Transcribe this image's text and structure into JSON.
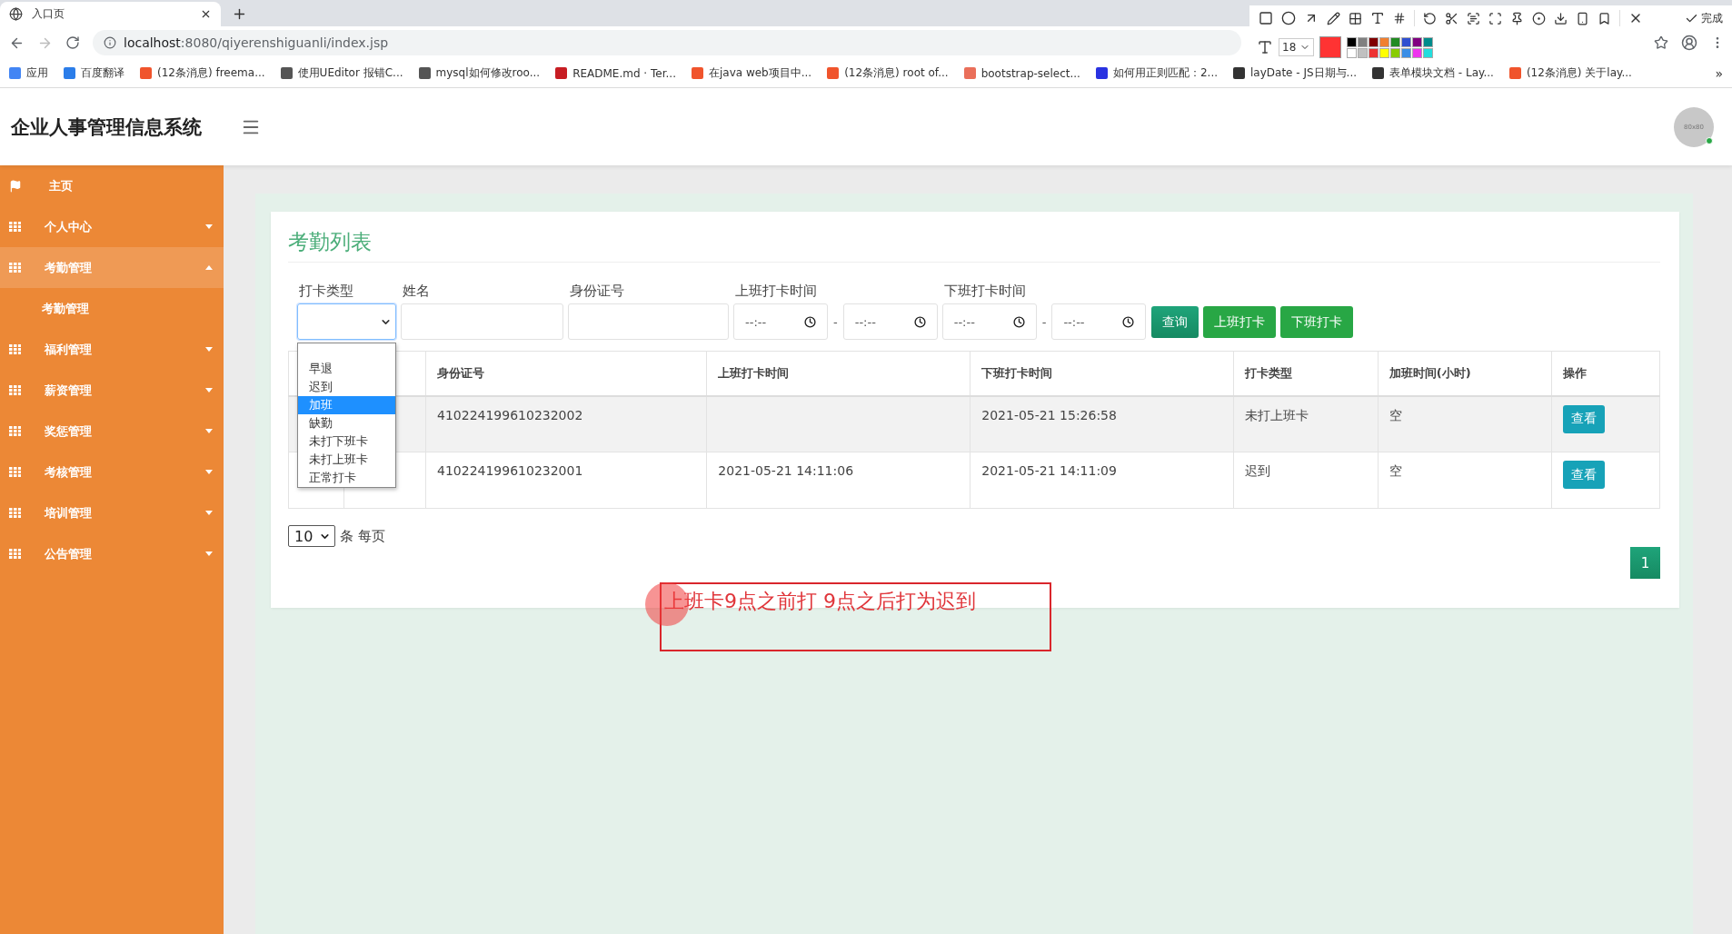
{
  "browser": {
    "tab_title": "入口页",
    "url_host": "localhost",
    "url_rest": ":8080/qiyerenshiguanli/index.jsp",
    "bookmarks": [
      {
        "label": "应用",
        "kind": "apps"
      },
      {
        "label": "百度翻译",
        "kind": "translate"
      },
      {
        "label": "(12条消息) freema...",
        "kind": "csdn"
      },
      {
        "label": "使用UEditor 报错C...",
        "kind": "feather"
      },
      {
        "label": "mysql如何修改roo...",
        "kind": "feather"
      },
      {
        "label": "README.md · Ter...",
        "kind": "gitee"
      },
      {
        "label": "在java web项目中...",
        "kind": "csdn"
      },
      {
        "label": "(12条消息) root of...",
        "kind": "csdn"
      },
      {
        "label": "bootstrap-select...",
        "kind": "jianshu"
      },
      {
        "label": "如何用正则匹配：2...",
        "kind": "baidu"
      },
      {
        "label": "layDate - JS日期与...",
        "kind": "layui"
      },
      {
        "label": "表单模块文档 - Lay...",
        "kind": "layui"
      },
      {
        "label": "(12条消息) 关于lay...",
        "kind": "csdn"
      }
    ],
    "more": "»"
  },
  "capture_toolbar": {
    "font_size": "18",
    "done_label": "完成"
  },
  "app": {
    "title": "企业人事管理信息系统",
    "avatar_text": "80x80"
  },
  "sidebar": {
    "items": [
      {
        "label": "主页",
        "kind": "link"
      },
      {
        "label": "个人中心",
        "kind": "group",
        "expanded": false
      },
      {
        "label": "考勤管理",
        "kind": "group",
        "expanded": true,
        "children": [
          {
            "label": "考勤管理"
          }
        ]
      },
      {
        "label": "福利管理",
        "kind": "group",
        "expanded": false
      },
      {
        "label": "薪资管理",
        "kind": "group",
        "expanded": false
      },
      {
        "label": "奖惩管理",
        "kind": "group",
        "expanded": false
      },
      {
        "label": "考核管理",
        "kind": "group",
        "expanded": false
      },
      {
        "label": "培训管理",
        "kind": "group",
        "expanded": false
      },
      {
        "label": "公告管理",
        "kind": "group",
        "expanded": false
      }
    ]
  },
  "page_title": "考勤列表",
  "filters": [
    {
      "label": "打卡类型",
      "kind": "select"
    },
    {
      "label": "姓名",
      "kind": "text"
    },
    {
      "label": "身份证号",
      "kind": "text"
    },
    {
      "label": "上班打卡时间",
      "kind": "time_range",
      "placeholders": [
        "--:--",
        "--:--"
      ],
      "separator": "-"
    },
    {
      "label": "下班打卡时间",
      "kind": "time_range",
      "placeholders": [
        "--:--",
        "--:--"
      ],
      "separator": "-"
    }
  ],
  "buttons": [
    {
      "label": "查询",
      "kind": "search"
    },
    {
      "label": "上班打卡",
      "kind": "action"
    },
    {
      "label": "下班打卡",
      "kind": "action"
    }
  ],
  "dropdown": {
    "options": [
      {
        "label": "早退",
        "selected": false
      },
      {
        "label": "迟到",
        "selected": false
      },
      {
        "label": "加班",
        "selected": true
      },
      {
        "label": "缺勤",
        "selected": false
      },
      {
        "label": "未打下班卡",
        "selected": false
      },
      {
        "label": "未打上班卡",
        "selected": false
      },
      {
        "label": "正常打卡",
        "selected": false
      }
    ]
  },
  "table": {
    "columns": [
      "身份证号",
      "上班打卡时间",
      "下班打卡时间",
      "打卡类型",
      "加班时间(小时)",
      "操作"
    ],
    "rows": [
      {
        "highlighted": true,
        "cells": [
          "410224199610232002",
          "",
          "2021-05-21 15:26:58",
          "未打上班卡",
          "空"
        ],
        "action": "查看"
      },
      {
        "highlighted": false,
        "cells": [
          "410224199610232001",
          "2021-05-21 14:11:06",
          "2021-05-21 14:11:09",
          "迟到",
          "空"
        ],
        "action": "查看"
      }
    ]
  },
  "pagination": {
    "page_size": "10",
    "page_size_suffix": "条 每页",
    "pages": [
      {
        "label": "1",
        "selected": true
      }
    ]
  },
  "annotation": {
    "text": "上班卡9点之前打 9点之后打为迟到"
  }
}
